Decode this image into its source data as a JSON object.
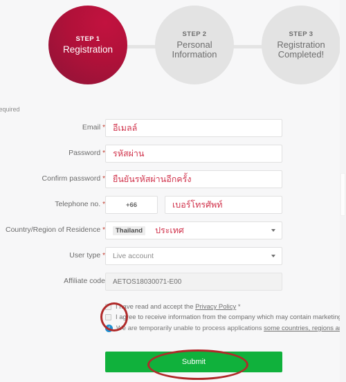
{
  "stepper": {
    "steps": [
      {
        "num": "STEP 1",
        "title": "Registration",
        "state": "active"
      },
      {
        "num": "STEP 2",
        "title": "Personal\nInformation",
        "state": "inactive"
      },
      {
        "num": "STEP 3",
        "title": "Registration\nCompleted!",
        "state": "inactive"
      }
    ],
    "step2_line1": "Personal",
    "step2_line2": "Information",
    "step3_line1": "Registration",
    "step3_line2": "Completed!",
    "active_color": "#b01139",
    "inactive_color": "#e3e3e3"
  },
  "required_note": "* Required",
  "form": {
    "email": {
      "label": "Email",
      "required_mark": "*",
      "value": "",
      "placeholder": "อีเมลล์"
    },
    "password": {
      "label": "Password",
      "required_mark": "*",
      "value": "",
      "placeholder": "รหัสผ่าน"
    },
    "confirm_password": {
      "label": "Confirm password",
      "required_mark": "*",
      "value": "",
      "placeholder": "ยืนยันรหัสผ่านอีกครั้ง"
    },
    "telephone": {
      "label": "Telephone no.",
      "required_mark": "*",
      "country_code": "+66",
      "value": "",
      "placeholder": "เบอร์โทรศัพท์"
    },
    "country": {
      "label": "Country/Region of Residence",
      "required_mark": "*",
      "selected": "Thailand",
      "hint": "ประเทศ"
    },
    "user_type": {
      "label": "User type",
      "required_mark": "*",
      "selected": "Live account"
    },
    "affiliate_code": {
      "label": "Affiliate code",
      "required_mark": "",
      "value": "AETOS18030071-E00"
    }
  },
  "consents": {
    "privacy": {
      "text_before": "I have read and accept the ",
      "link": "Privacy Policy",
      "text_after": " *",
      "checked": false
    },
    "marketing": {
      "text": "I agree to receive information from the company which may contain marketing materials",
      "checked": false
    },
    "notice": {
      "icon": "info-icon",
      "text_before": "We are temporarily unable to process applications ",
      "link": "some countries, regions and organisations"
    }
  },
  "submit": {
    "label": "Submit",
    "color": "#10b13c"
  },
  "annotations": {
    "color": "#b02a2a",
    "checkbox_ellipse": "highlight-checkboxes",
    "submit_ellipse": "highlight-submit"
  }
}
